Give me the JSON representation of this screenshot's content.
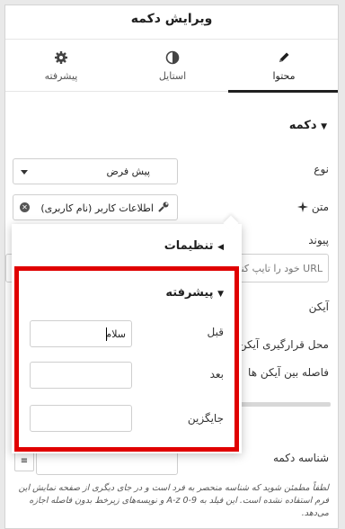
{
  "header": {
    "title": "ویرایش دکمه"
  },
  "tabs": [
    {
      "label": "محتوا",
      "icon": "pencil-icon",
      "active": true
    },
    {
      "label": "استایل",
      "icon": "contrast-icon",
      "active": false
    },
    {
      "label": "پیشرفته",
      "icon": "gear-icon",
      "active": false
    }
  ],
  "section": {
    "title": "دکمه"
  },
  "fields": {
    "type_label": "نوع",
    "type_value": "پیش فرض",
    "text_label": "متن",
    "text_value": "اطلاعات کاربر (نام کاربری)",
    "link_label": "پیوند",
    "link_placeholder": "URL خود را تایپ کنید",
    "icon_label": "آیکن",
    "icon_position_label": "محل قرارگیری آیکن",
    "icon_spacing_label": "فاصله بین آیکن ها",
    "button_id_label": "شناسه دکمه",
    "help_text": "لطفاً مطمئن شوید که شناسه منحصر به فرد است و در جای دیگری از صفحه نمایش این فرم استفاده نشده است. این فیلد به 9-0 A-z و نویسه‌های زیرخط بدون فاصله اجازه می‌دهد."
  },
  "popover": {
    "settings_title": "تنظیمات",
    "advanced_title": "پیشرفته",
    "before_label": "قبل",
    "before_value": "سلام",
    "after_label": "بعد",
    "after_value": "",
    "fallback_label": "جایگزین",
    "fallback_value": ""
  },
  "colors": {
    "highlight": "#e00000",
    "active_tab": "#1f1f1f"
  }
}
